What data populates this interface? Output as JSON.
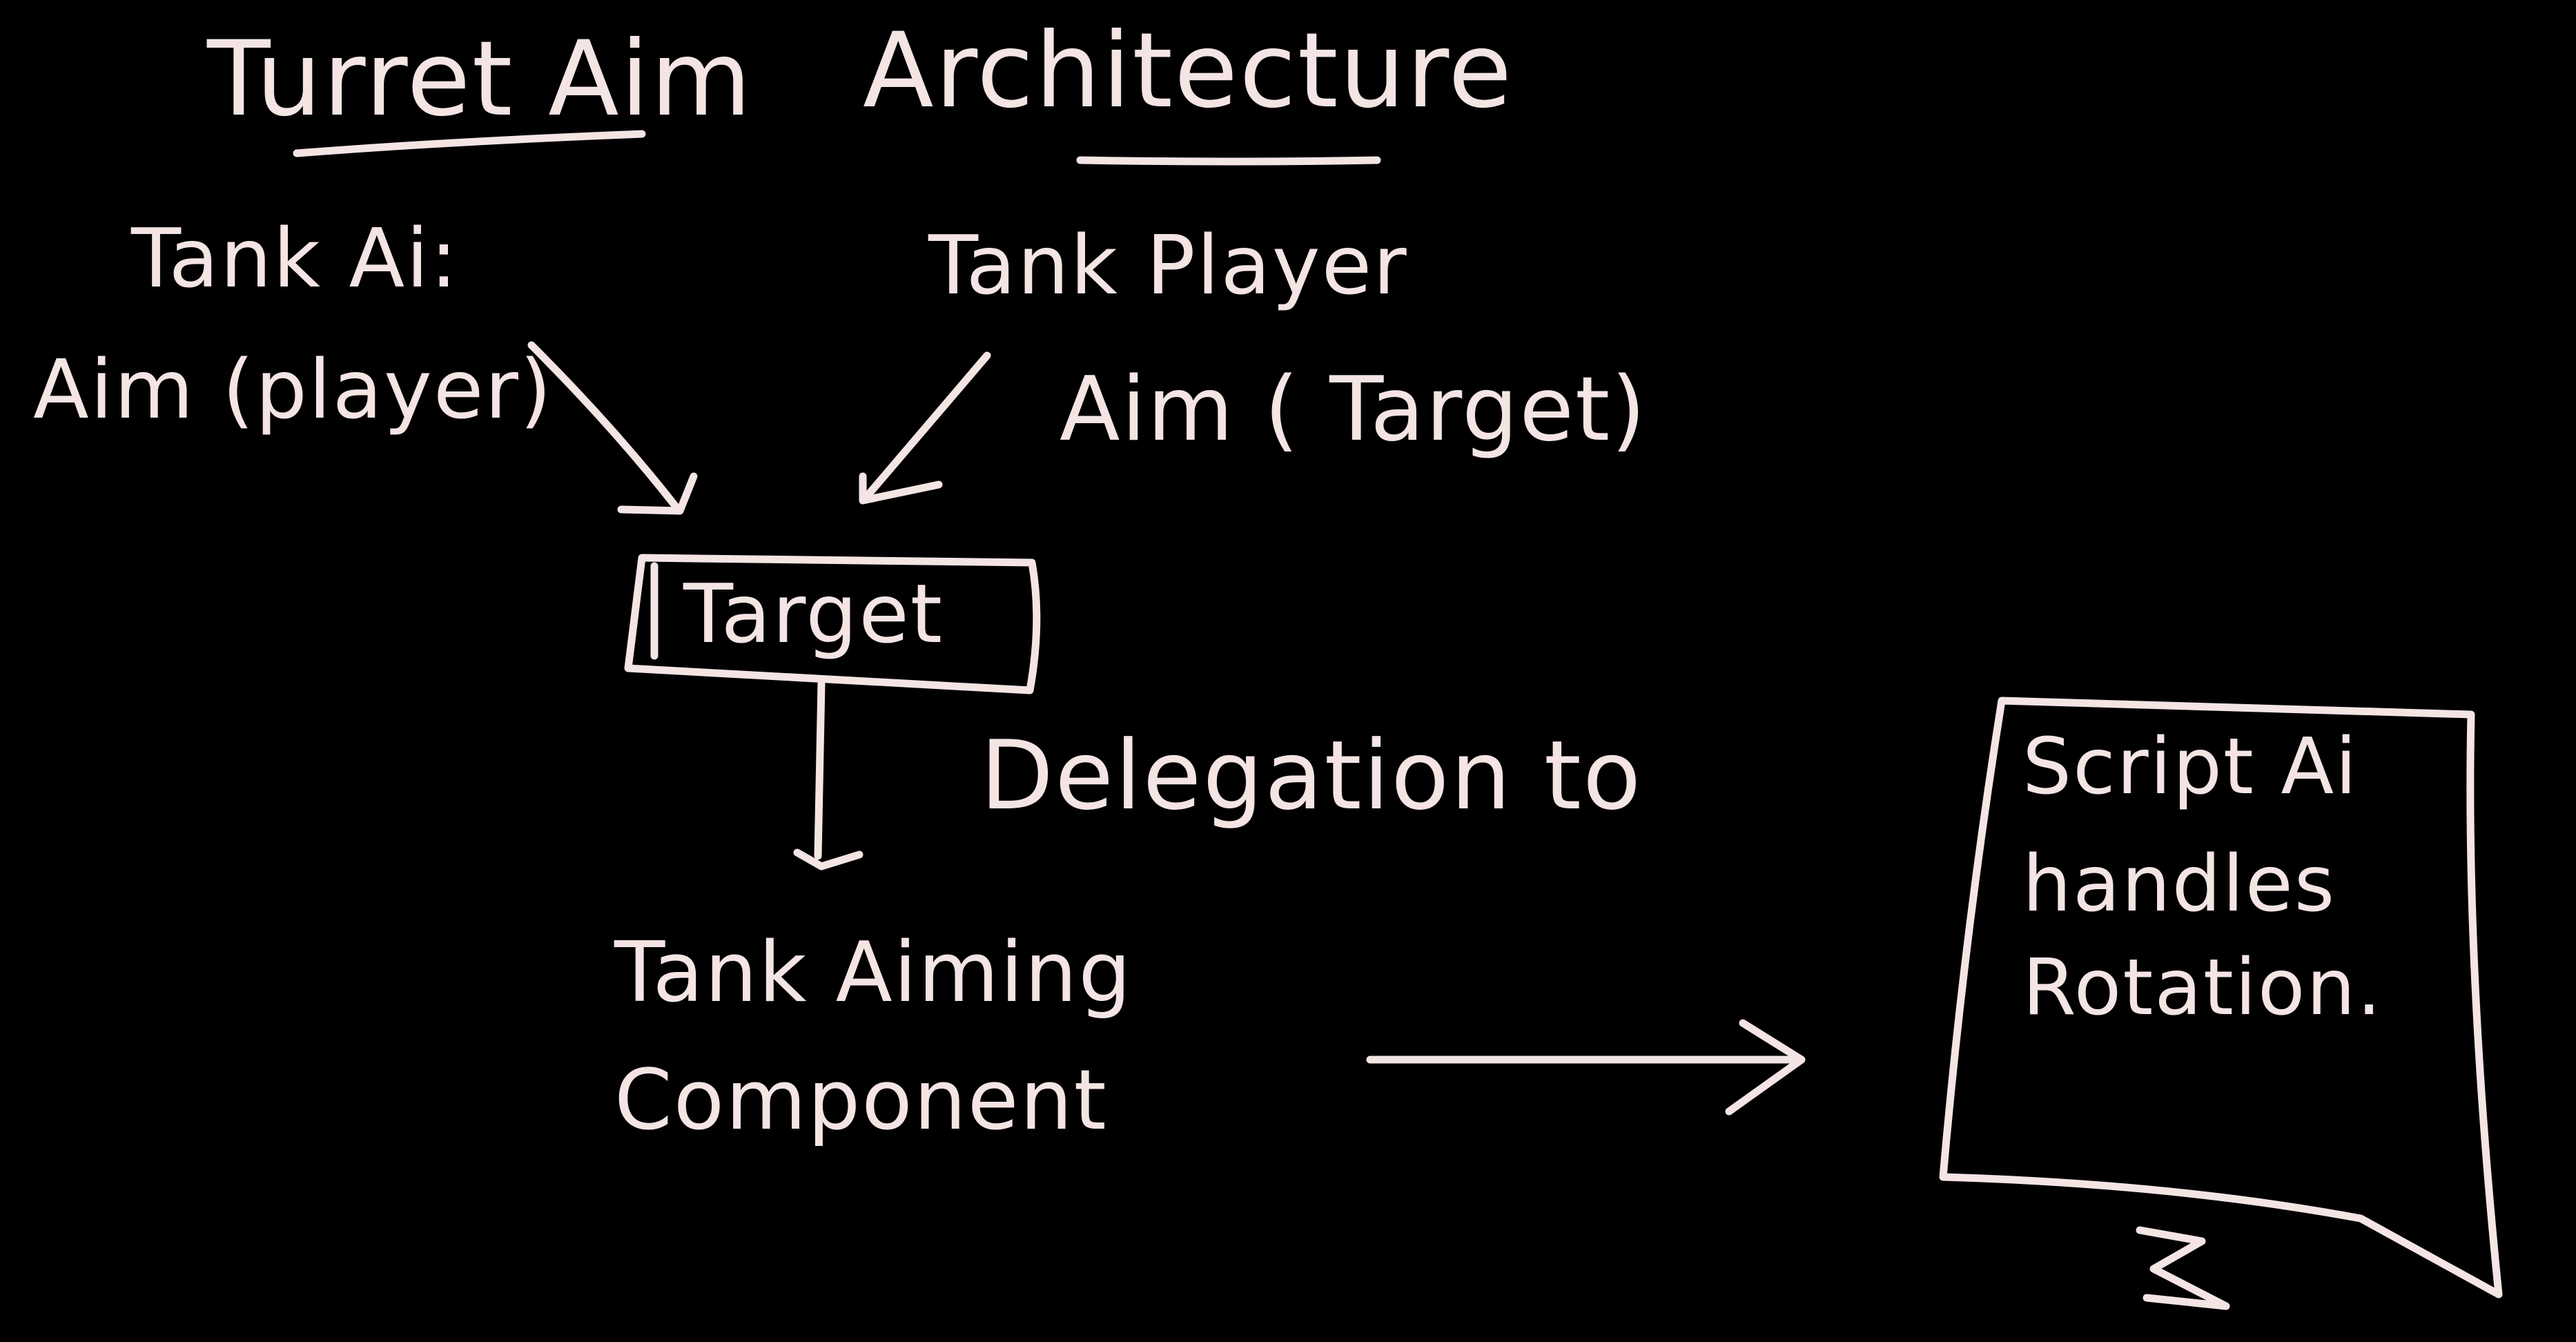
{
  "colors": {
    "background": "#000000",
    "ink": "#f4e4e4"
  },
  "title": {
    "left": "Turret Aim",
    "right": "Architecture"
  },
  "nodes": {
    "tank_ai": {
      "label": "Tank Ai:",
      "method": "Aim (player)"
    },
    "tank_player": {
      "label": "Tank Player",
      "method": "Aim ( Target)"
    },
    "target": {
      "label": "Target"
    },
    "aiming_component": {
      "line1": "Tank Aiming",
      "line2": "Component"
    },
    "script_note": {
      "line1": "Script Ai",
      "line2": "handles",
      "line3": "Rotation."
    }
  },
  "edges": {
    "delegation_label": "Delegation to"
  }
}
